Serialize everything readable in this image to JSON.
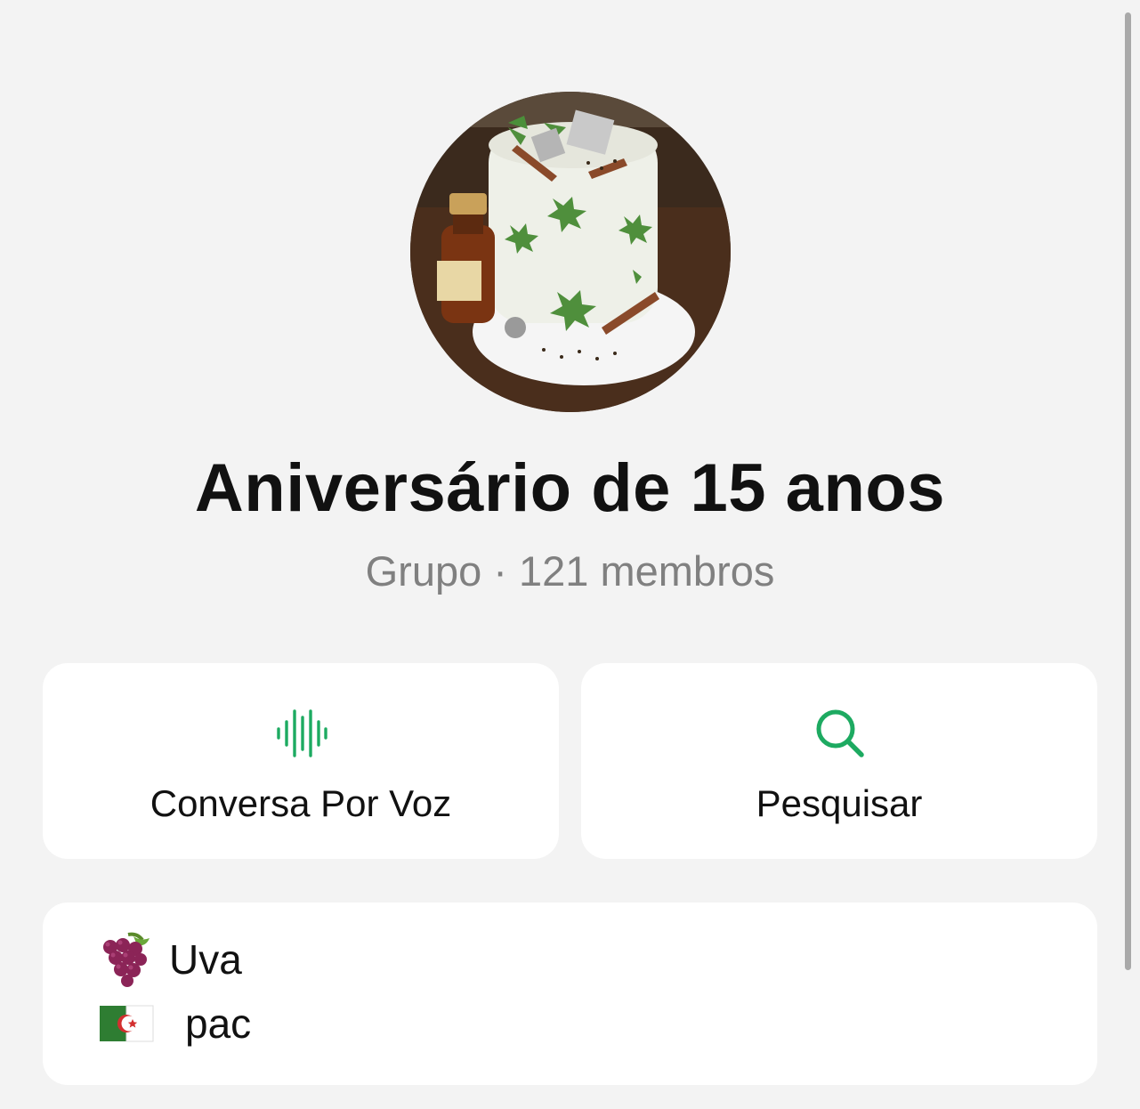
{
  "group": {
    "name": "Aniversário de 15 anos",
    "subtitle": "Grupo · 121 membros"
  },
  "actions": [
    {
      "label": "Conversa Por Voz",
      "icon": "voice-waveform-icon"
    },
    {
      "label": "Pesquisar",
      "icon": "search-icon"
    }
  ],
  "description": {
    "lines": [
      {
        "emoji": "grapes-emoji",
        "text": "Uva"
      },
      {
        "emoji": "algeria-flag-emoji",
        "text": "pac"
      }
    ]
  },
  "colors": {
    "accent": "#1daa61",
    "background": "#f3f3f3",
    "card": "#ffffff",
    "subtitle": "#808080"
  }
}
